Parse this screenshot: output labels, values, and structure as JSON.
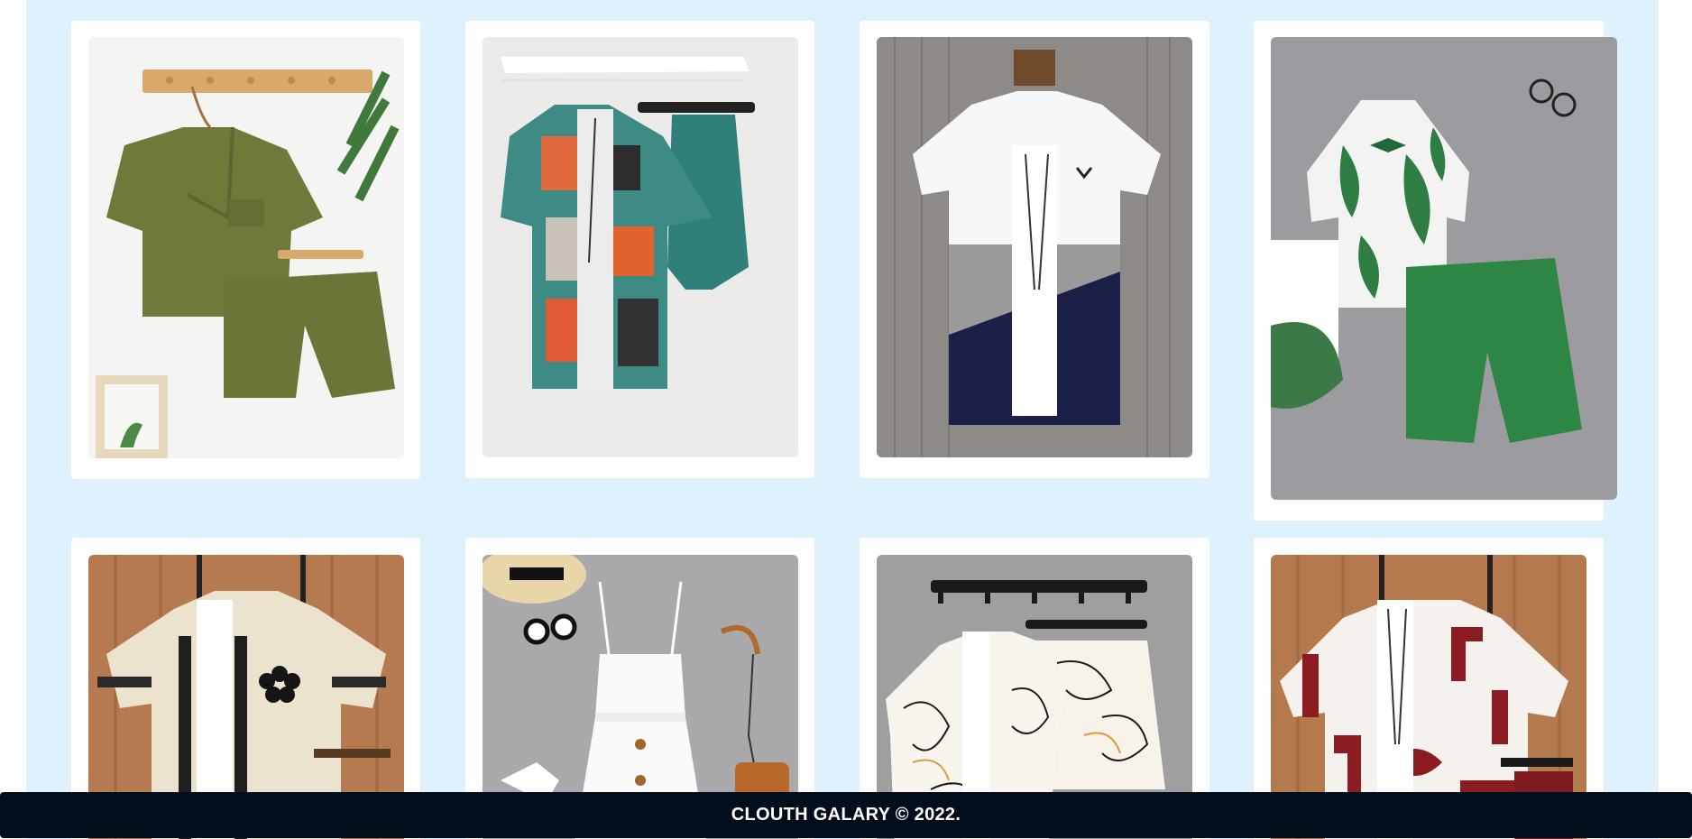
{
  "gallery": {
    "items": [
      {
        "name": "olive-green-wrap-shirt-and-shorts-set",
        "icon": "product-photo",
        "background": "#f4f4f2"
      },
      {
        "name": "patchwork-paisley-shirt-and-teal-shorts-set",
        "icon": "product-photo",
        "background": "#ecebea"
      },
      {
        "name": "white-grey-navy-colorblock-shirt",
        "icon": "product-photo",
        "background": "#8e8a87"
      },
      {
        "name": "kids-palm-leaf-shirt-and-green-shorts-set",
        "icon": "product-photo",
        "background": "#9c9ca0"
      },
      {
        "name": "beige-embroidered-shirt-set",
        "icon": "product-photo",
        "background": "#b57a4f"
      },
      {
        "name": "white-cami-button-dress",
        "icon": "product-photo",
        "background": "#a9a9ab"
      },
      {
        "name": "line-art-print-shirt-and-shorts-set",
        "icon": "product-photo",
        "background": "#9f9f9f"
      },
      {
        "name": "burgundy-geometric-print-shirt-set",
        "icon": "product-photo",
        "background": "#b4794d"
      }
    ]
  },
  "footer": {
    "text": "CLOUTH GALARY © 2022."
  },
  "colors": {
    "page_bg": "#dff1fd",
    "card_bg": "#ffffff",
    "footer_bg": "#020d1c",
    "footer_text": "#ffffff"
  }
}
